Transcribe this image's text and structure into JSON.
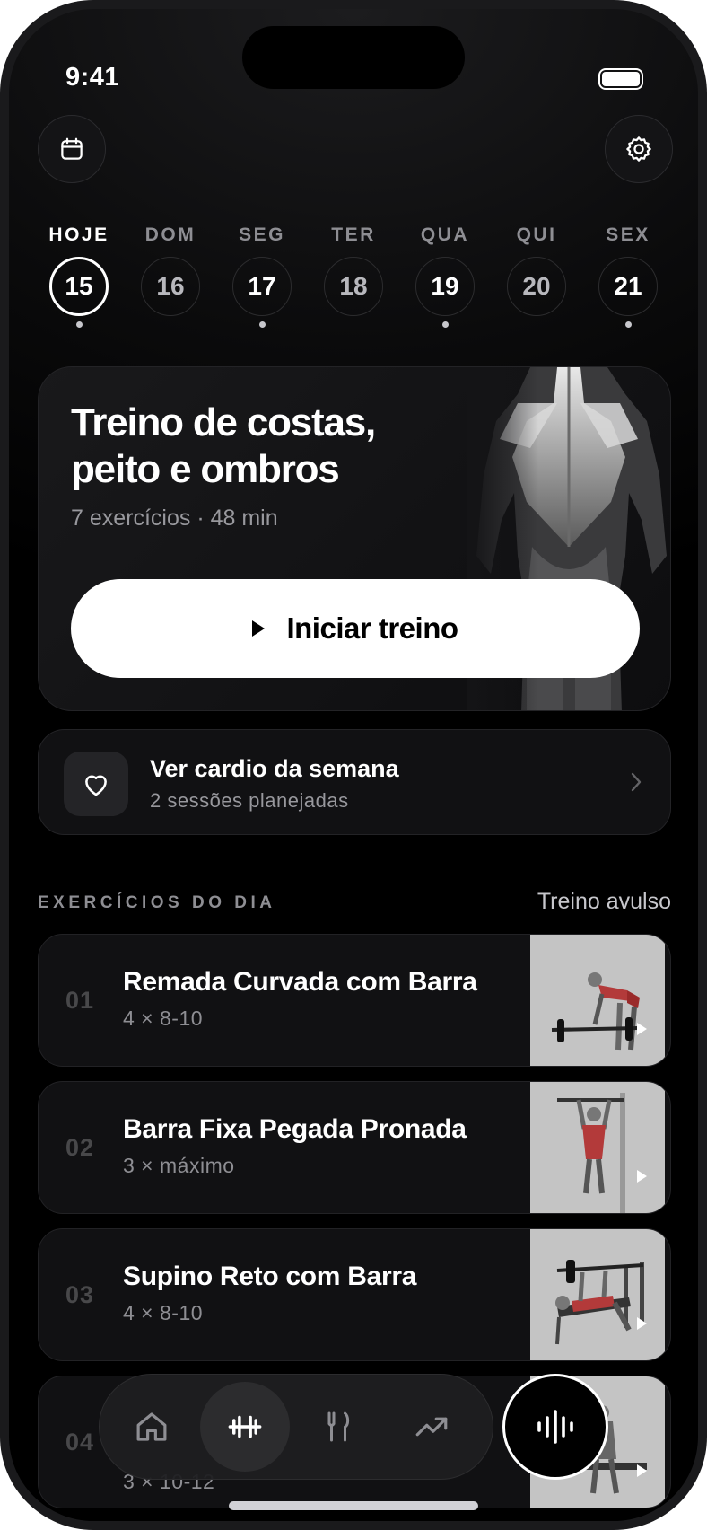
{
  "status_bar": {
    "time": "9:41"
  },
  "header": {
    "calendar_icon": "calendar-icon",
    "settings_icon": "gear-icon"
  },
  "week": [
    {
      "label": "HOJE",
      "day": "15",
      "active": true,
      "dot": true
    },
    {
      "label": "DOM",
      "day": "16",
      "active": false,
      "dot": false
    },
    {
      "label": "SEG",
      "day": "17",
      "active": false,
      "dot": true
    },
    {
      "label": "TER",
      "day": "18",
      "active": false,
      "dot": false
    },
    {
      "label": "QUA",
      "day": "19",
      "active": false,
      "dot": true
    },
    {
      "label": "QUI",
      "day": "20",
      "active": false,
      "dot": false
    },
    {
      "label": "SEX",
      "day": "21",
      "active": false,
      "dot": true
    }
  ],
  "workout": {
    "title": "Treino de costas, peito e ombros",
    "subtitle": "7 exercícios · 48 min",
    "start_label": "Iniciar treino"
  },
  "cardio": {
    "title": "Ver cardio da semana",
    "subtitle": "2 sessões planejadas"
  },
  "exercises_section": {
    "title": "EXERCÍCIOS DO DIA",
    "link": "Treino avulso",
    "items": [
      {
        "num": "01",
        "name": "Remada Curvada com Barra",
        "sets": "4 × 8-10"
      },
      {
        "num": "02",
        "name": "Barra Fixa Pegada Pronada",
        "sets": "3 × máximo"
      },
      {
        "num": "03",
        "name": "Supino Reto com Barra",
        "sets": "4 × 8-10"
      },
      {
        "num": "04",
        "name": "",
        "sets": "3 × 10-12"
      }
    ]
  },
  "tabbar": {
    "tabs": [
      "home-icon",
      "dumbbell-icon",
      "fork-knife-icon",
      "trending-up-icon"
    ],
    "active": "dumbbell-icon",
    "voice_icon": "voice-waveform-icon"
  },
  "colors": {
    "background": "#000000",
    "card": "#111113",
    "accent": "#ffffff",
    "muted": "#8e8e93"
  }
}
